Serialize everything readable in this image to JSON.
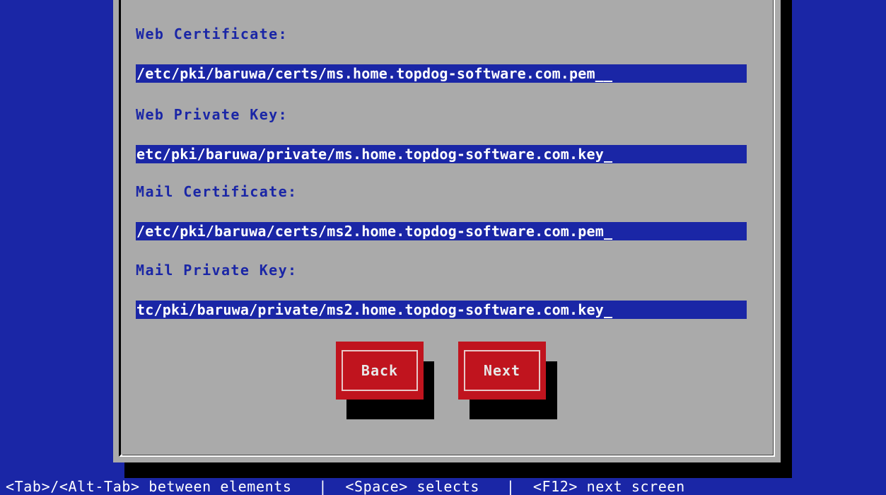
{
  "form": {
    "fields": [
      {
        "label": "Web Certificate:",
        "value": "/etc/pki/baruwa/certs/ms.home.topdog-software.com.pem__"
      },
      {
        "label": "Web Private Key:",
        "value": "etc/pki/baruwa/private/ms.home.topdog-software.com.key_"
      },
      {
        "label": "Mail Certificate:",
        "value": "/etc/pki/baruwa/certs/ms2.home.topdog-software.com.pem_"
      },
      {
        "label": "Mail Private Key:",
        "value": "tc/pki/baruwa/private/ms2.home.topdog-software.com.key_"
      }
    ]
  },
  "buttons": {
    "back_label": "Back",
    "next_label": "Next"
  },
  "help_bar": {
    "text": "<Tab>/<Alt-Tab> between elements   |  <Space> selects   |  <F12> next screen"
  },
  "colors": {
    "background": "#1a26a6",
    "dialog": "#aaaaaa",
    "entry_bg": "#1a26a6",
    "entry_fg": "#ffffff",
    "button": "#c0141e",
    "shadow": "#000000"
  }
}
